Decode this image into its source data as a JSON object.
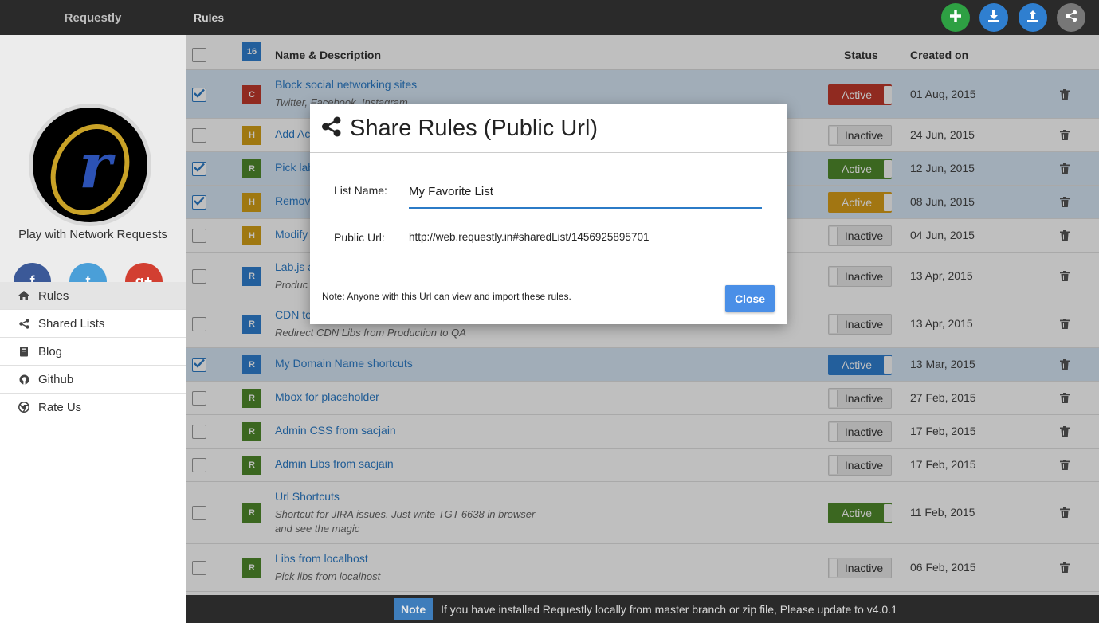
{
  "sidebar": {
    "brand": "Requestly",
    "tagline": "Play with Network Requests",
    "social": [
      {
        "icon": "facebook-icon",
        "glyph": "f",
        "color": "#3b5998"
      },
      {
        "icon": "twitter-icon",
        "glyph": "t",
        "color": "#4a9fd8"
      },
      {
        "icon": "google-plus-icon",
        "glyph": "g+",
        "color": "#d23f31"
      }
    ],
    "nav": [
      {
        "label": "Rules",
        "icon": "home-icon",
        "active": true
      },
      {
        "label": "Shared Lists",
        "icon": "share-icon",
        "active": false
      },
      {
        "label": "Blog",
        "icon": "book-icon",
        "active": false
      },
      {
        "label": "Github",
        "icon": "github-icon",
        "active": false
      },
      {
        "label": "Rate Us",
        "icon": "chrome-icon",
        "active": false
      }
    ]
  },
  "topbar": {
    "title": "Rules",
    "actions": [
      {
        "name": "add-rule-button",
        "icon": "plus-icon",
        "color": "#2ea043"
      },
      {
        "name": "import-button",
        "icon": "download-icon",
        "color": "#2f7fd0"
      },
      {
        "name": "export-button",
        "icon": "upload-icon",
        "color": "#2f7fd0"
      },
      {
        "name": "share-button",
        "icon": "share-icon",
        "color": "#777777"
      }
    ]
  },
  "table": {
    "count": "16",
    "headers": {
      "name": "Name & Description",
      "status": "Status",
      "created": "Created on"
    },
    "rows": [
      {
        "checked": true,
        "type": "C",
        "type_color": "#c0392b",
        "name": "Block social networking sites",
        "desc": "Twitter, Facebook, Instagram",
        "status": "Active",
        "status_color": "#c0392b",
        "date": "01 Aug, 2015"
      },
      {
        "checked": false,
        "type": "H",
        "type_color": "#d4a017",
        "name": "Add Ac",
        "desc": "",
        "status": "Inactive",
        "status_color": "",
        "date": "24 Jun, 2015"
      },
      {
        "checked": true,
        "type": "R",
        "type_color": "#4f8a2b",
        "name": "Pick lab",
        "desc": "",
        "status": "Active",
        "status_color": "#4f8a2b",
        "date": "12 Jun, 2015"
      },
      {
        "checked": true,
        "type": "H",
        "type_color": "#d4a017",
        "name": "Remov",
        "desc": "",
        "status": "Active",
        "status_color": "#d89e19",
        "date": "08 Jun, 2015"
      },
      {
        "checked": false,
        "type": "H",
        "type_color": "#d4a017",
        "name": "Modify",
        "desc": "",
        "status": "Inactive",
        "status_color": "",
        "date": "04 Jun, 2015"
      },
      {
        "checked": false,
        "type": "R",
        "type_color": "#2f7fd0",
        "name": "Lab.js a",
        "desc": "Produc",
        "status": "Inactive",
        "status_color": "",
        "date": "13 Apr, 2015"
      },
      {
        "checked": false,
        "type": "R",
        "type_color": "#2f7fd0",
        "name": "CDN to",
        "desc": "Redirect CDN Libs from Production to QA",
        "status": "Inactive",
        "status_color": "",
        "date": "13 Apr, 2015"
      },
      {
        "checked": true,
        "type": "R",
        "type_color": "#2f7fd0",
        "name": "My Domain Name shortcuts",
        "desc": "",
        "status": "Active",
        "status_color": "#2f7fd0",
        "date": "13 Mar, 2015"
      },
      {
        "checked": false,
        "type": "R",
        "type_color": "#4f8a2b",
        "name": "Mbox for placeholder",
        "desc": "",
        "status": "Inactive",
        "status_color": "",
        "date": "27 Feb, 2015"
      },
      {
        "checked": false,
        "type": "R",
        "type_color": "#4f8a2b",
        "name": "Admin CSS from sacjain",
        "desc": "",
        "status": "Inactive",
        "status_color": "",
        "date": "17 Feb, 2015"
      },
      {
        "checked": false,
        "type": "R",
        "type_color": "#4f8a2b",
        "name": "Admin Libs from sacjain",
        "desc": "",
        "status": "Inactive",
        "status_color": "",
        "date": "17 Feb, 2015"
      },
      {
        "checked": false,
        "type": "R",
        "type_color": "#4f8a2b",
        "name": "Url Shortcuts",
        "desc": "Shortcut for JIRA issues. Just write TGT-6638 in browser and see the magic",
        "status": "Active",
        "status_color": "#4f8a2b",
        "date": "11 Feb, 2015"
      },
      {
        "checked": false,
        "type": "R",
        "type_color": "#4f8a2b",
        "name": "Libs from localhost",
        "desc": "Pick libs from localhost",
        "status": "Inactive",
        "status_color": "",
        "date": "06 Feb, 2015"
      }
    ]
  },
  "modal": {
    "title": "Share Rules (Public Url)",
    "list_name_label": "List Name:",
    "list_name_value": "My Favorite List",
    "public_url_label": "Public Url:",
    "public_url": "http://web.requestly.in#sharedList/1456925895701",
    "note": "Note: Anyone with this Url can view and import these rules.",
    "close_label": "Close"
  },
  "footer": {
    "badge": "Note",
    "text": "If you have installed Requestly locally from master branch or zip file, Please update to v4.0.1"
  }
}
